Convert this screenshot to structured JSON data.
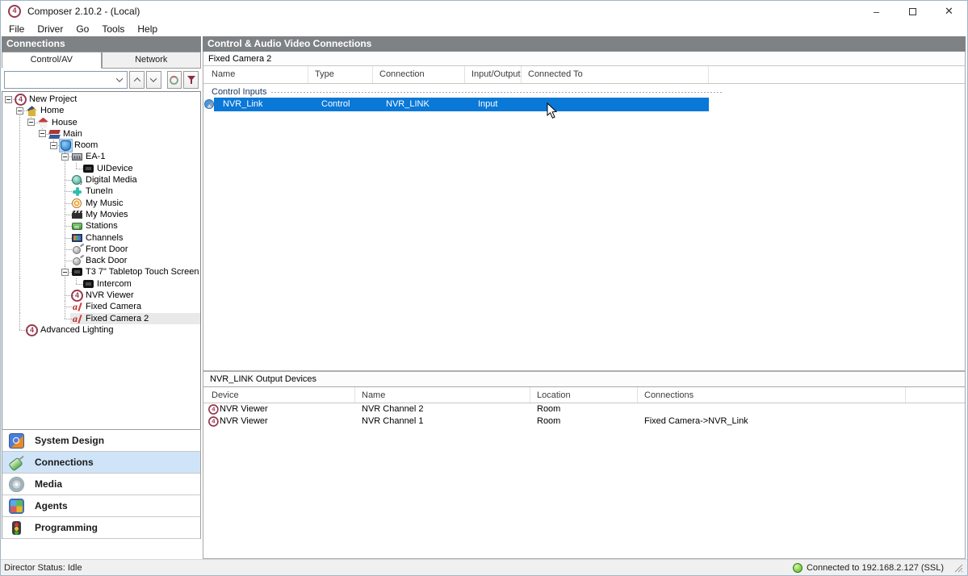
{
  "window": {
    "title": "Composer 2.10.2 - (Local)",
    "app_icon": "control4-logo",
    "controls": [
      {
        "name": "minimize",
        "glyph": "–"
      },
      {
        "name": "maximize",
        "glyph": ""
      },
      {
        "name": "close",
        "glyph": "✕"
      }
    ]
  },
  "menu_bar": [
    "File",
    "Driver",
    "Go",
    "Tools",
    "Help"
  ],
  "colors": {
    "selection_blue": "#0a78d7",
    "header_gray": "#7f8285",
    "nav_selected_blue": "#cfe4f8",
    "status_green": "#54b61e",
    "brand_maroon": "#963a52"
  },
  "left_panel": {
    "header": "Connections",
    "tabs": [
      {
        "label": "Control/AV",
        "active": true
      },
      {
        "label": "Network",
        "active": false
      }
    ],
    "filter_toolbar": {
      "combo_value": "",
      "buttons": [
        {
          "name": "find-previous",
          "icon": "chevron-up"
        },
        {
          "name": "find-next",
          "icon": "chevron-down"
        },
        {
          "name": "refresh",
          "icon": "refresh"
        },
        {
          "name": "filter",
          "icon": "funnel"
        }
      ]
    },
    "tree": [
      {
        "label": "New Project",
        "icon": "c4",
        "depth": 0,
        "expanded": true
      },
      {
        "label": "Home",
        "icon": "home",
        "depth": 1,
        "expanded": true
      },
      {
        "label": "House",
        "icon": "house",
        "depth": 2,
        "expanded": true
      },
      {
        "label": "Main",
        "icon": "floor",
        "depth": 3,
        "expanded": true
      },
      {
        "label": "Room",
        "icon": "room",
        "depth": 4,
        "expanded": true,
        "icon_highlight": true
      },
      {
        "label": "EA-1",
        "icon": "controller",
        "depth": 5,
        "expanded": true
      },
      {
        "label": "UIDevice",
        "icon": "touchscreen",
        "depth": 6
      },
      {
        "label": "Digital Media",
        "icon": "digital-media",
        "depth": 5
      },
      {
        "label": "TuneIn",
        "icon": "tunein",
        "depth": 5
      },
      {
        "label": "My Music",
        "icon": "my-music",
        "depth": 5
      },
      {
        "label": "My Movies",
        "icon": "my-movies",
        "depth": 5
      },
      {
        "label": "Stations",
        "icon": "stations",
        "depth": 5
      },
      {
        "label": "Channels",
        "icon": "channels",
        "depth": 5
      },
      {
        "label": "Front Door",
        "icon": "door",
        "depth": 5
      },
      {
        "label": "Back Door",
        "icon": "door",
        "depth": 5
      },
      {
        "label": "T3 7\" Tabletop Touch Screen",
        "icon": "touchscreen",
        "depth": 5,
        "expanded": true
      },
      {
        "label": "Intercom",
        "icon": "touchscreen",
        "depth": 6
      },
      {
        "label": "NVR Viewer",
        "icon": "c4",
        "depth": 5
      },
      {
        "label": "Fixed Camera",
        "icon": "camera",
        "depth": 5
      },
      {
        "label": "Fixed Camera 2",
        "icon": "camera",
        "depth": 5,
        "selected": true
      },
      {
        "label": "Advanced Lighting",
        "icon": "c4",
        "depth": 1
      }
    ],
    "nav": [
      {
        "label": "System Design",
        "icon": "system-design",
        "selected": false
      },
      {
        "label": "Connections",
        "icon": "connections",
        "selected": true
      },
      {
        "label": "Media",
        "icon": "media",
        "selected": false
      },
      {
        "label": "Agents",
        "icon": "agents",
        "selected": false
      },
      {
        "label": "Programming",
        "icon": "programming",
        "selected": false
      }
    ]
  },
  "right_panel": {
    "header": "Control & Audio Video Connections",
    "device_title": "Fixed Camera 2",
    "connections_table": {
      "columns": [
        "Name",
        "Type",
        "Connection",
        "Input/Output",
        "Connected To"
      ],
      "group_label": "Control Inputs",
      "rows": [
        {
          "icon": "control-binding",
          "name": "NVR_Link",
          "type": "Control",
          "connection": "NVR_LINK",
          "input_output": "Input",
          "connected_to": "",
          "selected": true
        }
      ]
    },
    "output_panel": {
      "header": "NVR_LINK Output Devices",
      "columns": [
        "Device",
        "Name",
        "Location",
        "Connections"
      ],
      "rows": [
        {
          "icon": "c4",
          "device": "NVR Viewer",
          "name": "NVR Channel 2",
          "location": "Room",
          "connections": ""
        },
        {
          "icon": "c4",
          "device": "NVR Viewer",
          "name": "NVR Channel 1",
          "location": "Room",
          "connections": "Fixed Camera->NVR_Link"
        }
      ]
    }
  },
  "status_bar": {
    "director_status": "Director Status: Idle",
    "connection_status": "Connected to 192.168.2.127 (SSL)"
  }
}
